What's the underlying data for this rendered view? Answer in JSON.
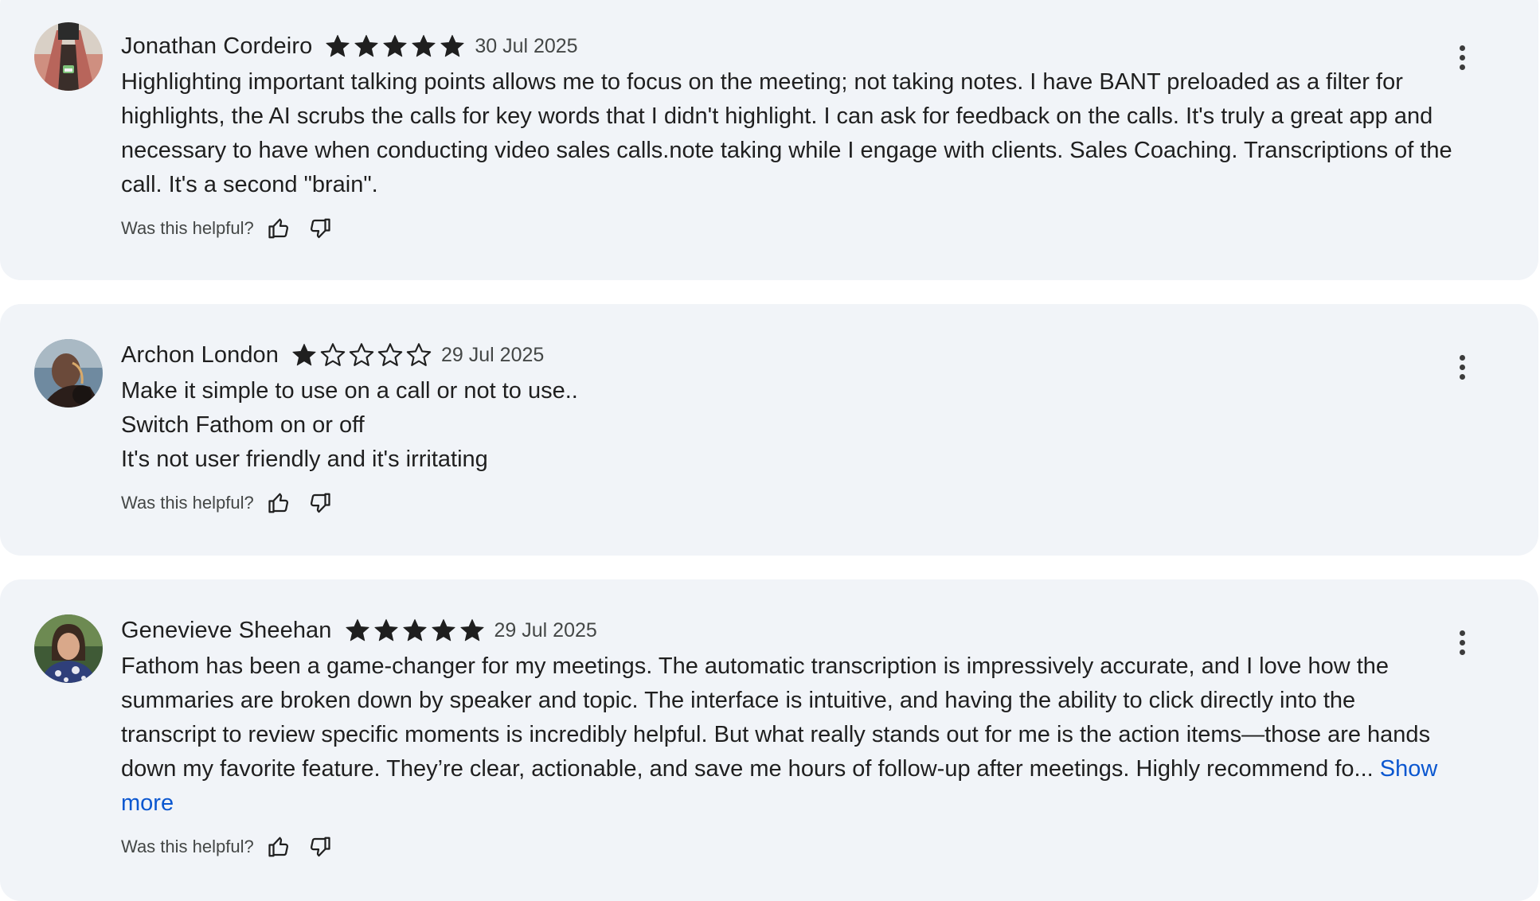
{
  "helpful_label": "Was this helpful?",
  "colors": {
    "card_bg": "#f1f4f8",
    "star": "#1f1f1f",
    "link": "#0b57d0",
    "meta": "#444746"
  },
  "reviews": [
    {
      "author": "Jonathan Cordeiro",
      "rating": 5,
      "date": "30 Jul 2025",
      "text": "Highlighting important talking points allows me to focus on the meeting; not taking notes. I have BANT preloaded as a filter for highlights, the AI scrubs the calls for key words that I didn't highlight. I can ask for feedback on the calls. It's truly a great app and necessary to have when conducting video sales calls.note taking while I engage with clients. Sales Coaching. Transcriptions of the call. It's a second \"brain\"."
    },
    {
      "author": "Archon London",
      "rating": 1,
      "date": "29 Jul 2025",
      "text": "Make it simple to use on a call or not to use..\nSwitch Fathom on or off\nIt's not user friendly and it's irritating"
    },
    {
      "author": "Genevieve Sheehan",
      "rating": 5,
      "date": "29 Jul 2025",
      "text": "Fathom has been a game-changer for my meetings. The automatic transcription is impressively accurate, and I love how the summaries are broken down by speaker and topic. The interface is intuitive, and having the ability to click directly into the transcript to review specific moments is incredibly helpful. But what really stands out for me is the action items—those are hands down my favorite feature. They’re clear, actionable, and save me hours of follow-up after meetings. Highly recommend fo... ",
      "show_more": "Show more"
    }
  ]
}
